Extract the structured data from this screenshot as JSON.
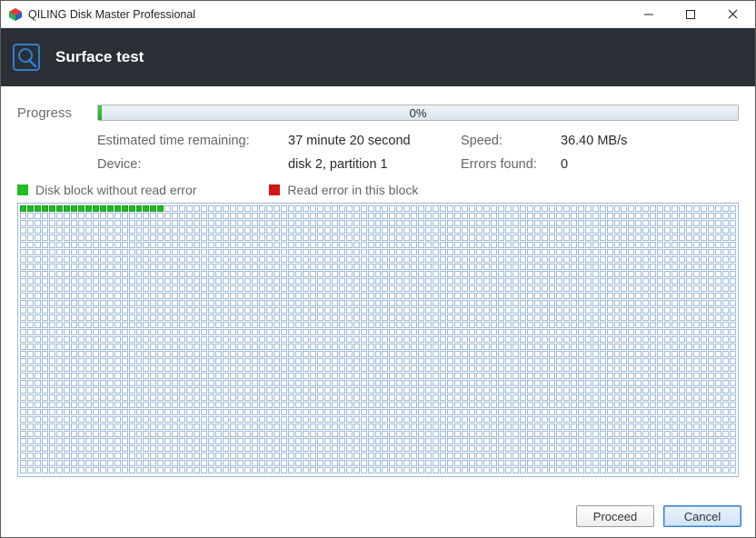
{
  "window": {
    "title": "QILING Disk Master Professional"
  },
  "header": {
    "title": "Surface test"
  },
  "progress": {
    "label": "Progress",
    "percent_text": "0%",
    "percent_value": 0
  },
  "info": {
    "eta_label": "Estimated time remaining:",
    "eta_value": "37 minute 20 second",
    "speed_label": "Speed:",
    "speed_value": "36.40 MB/s",
    "device_label": "Device:",
    "device_value": "disk 2, partition 1",
    "errors_label": "Errors found:",
    "errors_value": "0"
  },
  "legend": {
    "ok_label": "Disk block without read error",
    "err_label": "Read error in this block"
  },
  "grid": {
    "cols": 99,
    "rows": 37,
    "scanned_ok": 20
  },
  "buttons": {
    "proceed": "Proceed",
    "cancel": "Cancel"
  }
}
